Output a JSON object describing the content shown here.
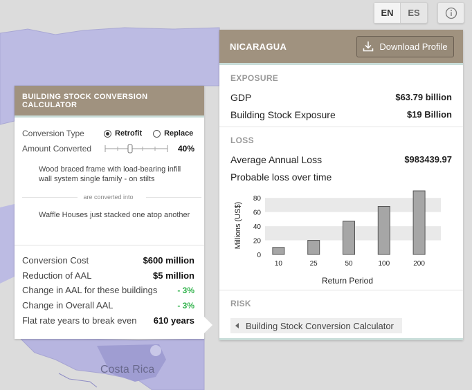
{
  "map": {
    "label": "Costa Rica"
  },
  "language": {
    "en": "EN",
    "es": "ES"
  },
  "profile": {
    "title": "NICARAGUA",
    "download_label": "Download Profile",
    "exposure": {
      "title": "EXPOSURE",
      "rows": [
        {
          "label": "GDP",
          "value": "$63.79 billion"
        },
        {
          "label": "Building Stock Exposure",
          "value": "$19 Billion"
        }
      ]
    },
    "loss": {
      "title": "LOSS",
      "aal_label": "Average Annual Loss",
      "aal_value": "$983439.97",
      "plot_label": "Probable loss over time"
    },
    "risk": {
      "title": "RISK",
      "link_label": "Building Stock Conversion Calculator"
    }
  },
  "chart_data": {
    "type": "bar",
    "categories": [
      "10",
      "25",
      "50",
      "100",
      "200"
    ],
    "values": [
      10,
      20,
      47,
      68,
      90
    ],
    "xlabel": "Return Period",
    "ylabel": "Millions (US$)",
    "yticks": [
      0,
      20,
      40,
      60,
      80
    ],
    "ylim": [
      0,
      90
    ],
    "bar_color": "#a6a6a6",
    "band_color": "#e9e9e9"
  },
  "calculator": {
    "title": "BUILDING STOCK CONVERSION CALCULATOR",
    "conversion_type_label": "Conversion Type",
    "option_retrofit": "Retrofit",
    "option_replace": "Replace",
    "amount_label": "Amount Converted",
    "amount_value": "40%",
    "amount_fraction": 0.4,
    "source_type": "Wood braced frame with load-bearing infill wall system single family - on stilts",
    "converted_into": "are converted into",
    "target_type": "Waffle Houses just stacked one atop another",
    "results": [
      {
        "label": "Conversion Cost",
        "value": "$600 million",
        "green": false
      },
      {
        "label": "Reduction of AAL",
        "value": "$5 million",
        "green": false
      },
      {
        "label": "Change in AAL for these buildings",
        "value": "- 3%",
        "green": true
      },
      {
        "label": "Change in Overall AAL",
        "value": "- 3%",
        "green": true
      },
      {
        "label": "Flat rate years to break even",
        "value": "610 years",
        "green": false
      }
    ]
  },
  "colors": {
    "header": "#a0927f",
    "accent": "#c9ddd9",
    "map_land": "#b7b5e0",
    "positive": "#2fb24a"
  }
}
